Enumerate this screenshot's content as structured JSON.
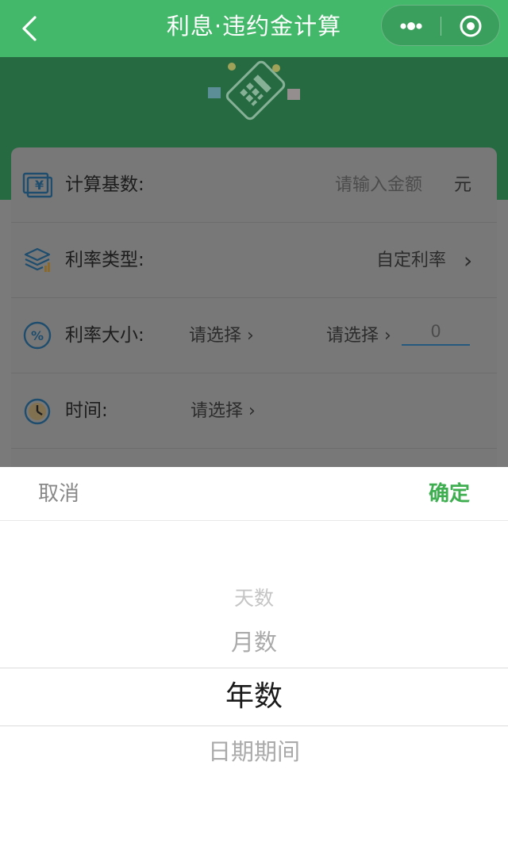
{
  "nav": {
    "title": "利息·违约金计算",
    "back_icon": "back-chevron-icon",
    "more_icon": "more-dots-icon",
    "close_icon": "target-circle-icon"
  },
  "form": {
    "rows": [
      {
        "icon": "yen-card-icon",
        "label": "计算基数:",
        "placeholder": "请输入金额",
        "unit": "元"
      },
      {
        "icon": "layers-icon",
        "label": "利率类型:",
        "value": "自定利率",
        "chevron": "›"
      },
      {
        "icon": "percent-icon",
        "label": "利率大小:",
        "select1": "请选择",
        "select2": "请选择",
        "input_value": "0"
      },
      {
        "icon": "clock-icon",
        "label": "时间:",
        "select": "请选择"
      }
    ]
  },
  "picker": {
    "cancel_label": "取消",
    "confirm_label": "确定",
    "options": [
      "天数",
      "月数",
      "年数",
      "日期期间"
    ],
    "selected": "年数"
  },
  "colors": {
    "nav_green": "#43b86a",
    "banner_green": "#266a41",
    "confirm_green": "#3eae51"
  }
}
